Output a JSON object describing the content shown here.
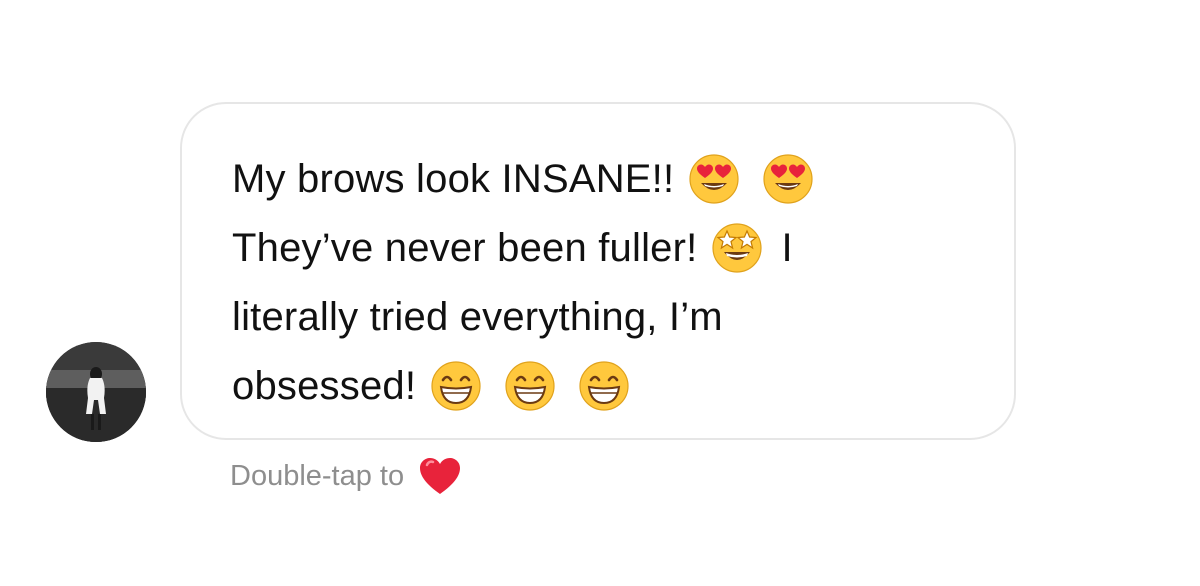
{
  "conversation": {
    "avatar_icon": "profile-photo-icon",
    "message": {
      "lines": [
        {
          "text": "My brows look INSANE!!",
          "emojis": [
            "heart-eyes-emoji",
            "heart-eyes-emoji"
          ],
          "tail": ""
        },
        {
          "text": "They’ve never been fuller!",
          "emojis": [
            "star-struck-emoji"
          ],
          "tail": "I"
        },
        {
          "text": "literally tried everything, I’m",
          "emojis": [],
          "tail": ""
        },
        {
          "text": "obsessed!",
          "emojis": [
            "grinning-emoji",
            "grinning-emoji",
            "grinning-emoji"
          ],
          "tail": ""
        }
      ]
    },
    "hint": {
      "label": "Double-tap to",
      "icon": "red-heart-icon"
    },
    "colors": {
      "bubble_border": "#e6e6e6",
      "text": "#111111",
      "hint_text": "#8e8e8e",
      "heart": "#e8233b",
      "emoji_face": "#ffc83d"
    }
  }
}
